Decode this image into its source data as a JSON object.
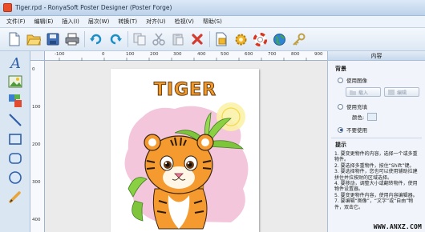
{
  "window": {
    "title": "Tiger.rpd - RonyaSoft Poster Designer (Poster Forge)"
  },
  "menu": [
    "文件(F)",
    "编辑(E)",
    "插入(I)",
    "层次(W)",
    "转换(T)",
    "对齐(U)",
    "检视(V)",
    "帮助(S)"
  ],
  "toolbar": [
    "new-icon",
    "open-icon",
    "save-icon",
    "print-icon",
    "undo-icon",
    "redo-icon",
    "copy-icon",
    "cut-icon",
    "paste-icon",
    "delete-icon",
    "page-setup-icon",
    "settings-icon",
    "help-icon",
    "web-icon",
    "key-icon"
  ],
  "left_tools": [
    "text-icon",
    "image-icon",
    "clipart-icon",
    "line-icon",
    "rectangle-icon",
    "rounded-rectangle-icon",
    "ellipse-icon",
    "pencil-icon"
  ],
  "ruler": {
    "top_ticks": [
      "-100",
      "0",
      "100",
      "200",
      "300",
      "400",
      "500",
      "600",
      "700",
      "800",
      "900"
    ],
    "left_ticks": [
      "0",
      "100",
      "200",
      "300",
      "400"
    ]
  },
  "poster": {
    "title": "TIGER"
  },
  "panel": {
    "header": "内容",
    "background_title": "背景",
    "use_image": "使用图像",
    "load_button": "载入",
    "edit_button": "编辑",
    "use_fill": "使用充填",
    "color_label": "颜色:",
    "no_use": "不要使用",
    "tips_title": "提示",
    "tips": [
      "1. 要变更物件的内容，选择一个或多重物件。",
      "2. 要选择多重物件，按住“Shift”键。",
      "3. 要选择物件，您也可以使用辅助拉建拼住并拉按财的区域选择。",
      "4. 要移动，调整大小或翻转物件，使用物件设置器。",
      "5. 要变更物件内容，使用内容编辑器。",
      "7. 要编辑“图像”，“文字”或“自由”物件，双击它。"
    ]
  },
  "watermark": "WWW.ANXZ.COM"
}
